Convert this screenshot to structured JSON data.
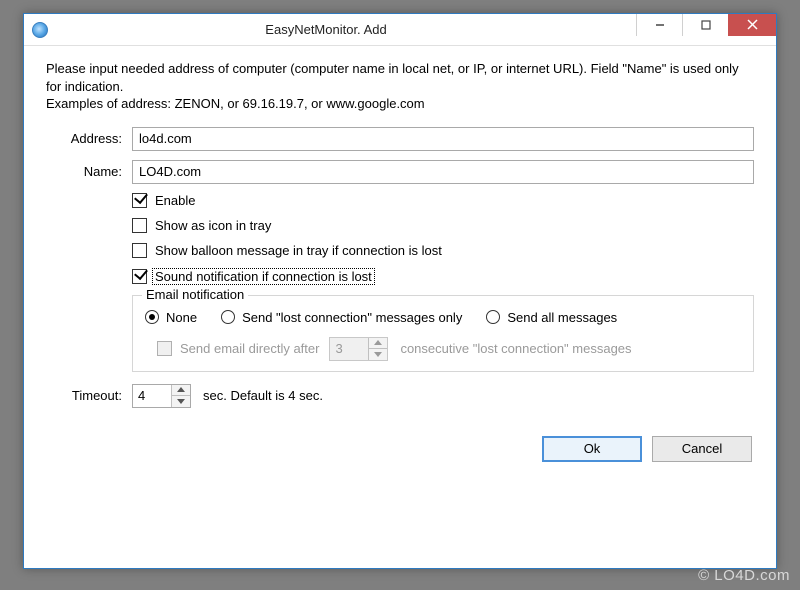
{
  "window": {
    "title": "EasyNetMonitor. Add"
  },
  "instructions": {
    "line1": "Please input needed address of computer (computer name in local net, or IP, or internet URL). Field \"Name\" is used only for indication.",
    "line2": "Examples of address:   ZENON, or  69.16.19.7,  or www.google.com"
  },
  "fields": {
    "address_label": "Address:",
    "address_value": "lo4d.com",
    "name_label": "Name:",
    "name_value": "LO4D.com"
  },
  "options": {
    "enable": "Enable",
    "show_tray_icon": "Show as icon in tray",
    "show_balloon": "Show balloon message in tray if connection is lost",
    "sound_notification": "Sound notification if connection is lost"
  },
  "email": {
    "group_label": "Email notification",
    "none": "None",
    "lost_only": "Send \"lost connection\" messages only",
    "send_all": "Send all messages",
    "direct_prefix": "Send email directly after",
    "direct_value": "3",
    "direct_suffix": "consecutive \"lost connection\" messages"
  },
  "timeout": {
    "label": "Timeout:",
    "value": "4",
    "suffix": "sec. Default is 4 sec."
  },
  "buttons": {
    "ok": "Ok",
    "cancel": "Cancel"
  },
  "watermark": "© LO4D.com"
}
